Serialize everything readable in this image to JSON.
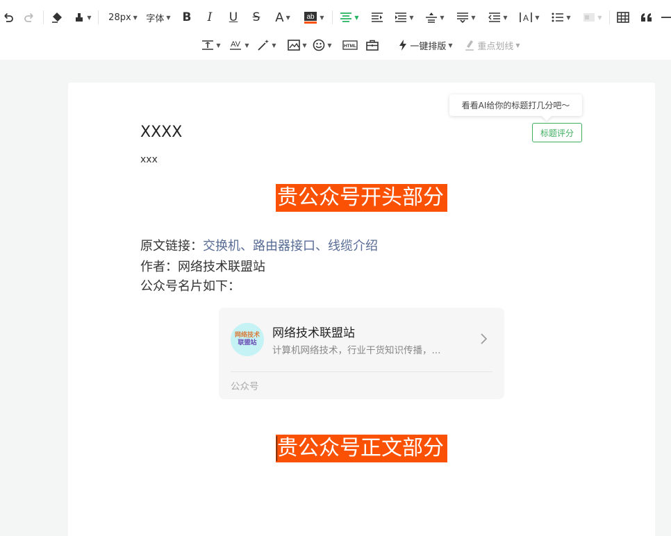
{
  "toolbar": {
    "font_size": "28px",
    "font_family": "字体",
    "one_click_layout": "一键排版",
    "key_underline": "重点划线"
  },
  "tooltip": {
    "text": "看看AI给你的标题打几分吧～"
  },
  "score_button": {
    "label": "标题评分"
  },
  "article": {
    "title": "XXXX",
    "author": "xxx",
    "banner_top": "贵公众号开头部分",
    "source_label": "原文链接：",
    "source_link": "交换机、路由器接口、线缆介绍",
    "author_line": "作者：网络技术联盟站",
    "card_intro": "公众号名片如下：",
    "banner_body": "贵公众号正文部分"
  },
  "account_card": {
    "avatar_line1": "网络技术",
    "avatar_line2": "联盟站",
    "name": "网络技术联盟站",
    "description": "计算机网络技术，行业干货知识传播，...",
    "footer": "公众号"
  },
  "colors": {
    "banner": "#fa5105",
    "accent_green": "#3fae5f",
    "link": "#576b95"
  }
}
